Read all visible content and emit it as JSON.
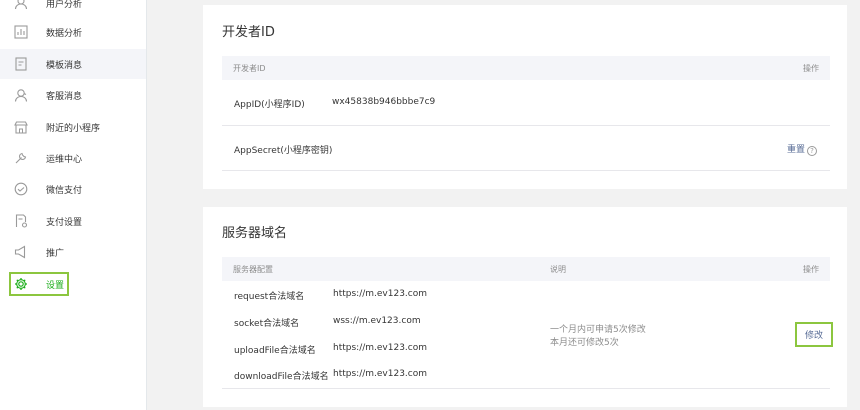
{
  "sidebar": {
    "items": [
      {
        "label": "用户分析",
        "icon": "user-icon"
      },
      {
        "label": "数据分析",
        "icon": "bar-chart-icon"
      },
      {
        "label": "模板消息",
        "icon": "template-doc-icon"
      },
      {
        "label": "客服消息",
        "icon": "customer-service-icon"
      },
      {
        "label": "附近的小程序",
        "icon": "store-icon"
      },
      {
        "label": "运维中心",
        "icon": "wrench-icon"
      },
      {
        "label": "微信支付",
        "icon": "check-circle-icon"
      },
      {
        "label": "支付设置",
        "icon": "payment-settings-icon"
      },
      {
        "label": "推广",
        "icon": "megaphone-icon"
      },
      {
        "label": "设置",
        "icon": "gear-icon"
      }
    ],
    "accent_color": "#1aad19",
    "highlight_color": "#8cc63f"
  },
  "developer_id": {
    "title": "开发者ID",
    "header_label": "开发者ID",
    "header_action": "操作",
    "appid_label": "AppID(小程序ID)",
    "appid_value": "wx45838b946bbbe7c9",
    "appsecret_label": "AppSecret(小程序密钥)",
    "reset_label": "重置",
    "help_icon": "?"
  },
  "server_domain": {
    "title": "服务器域名",
    "header_config": "服务器配置",
    "header_desc": "说明",
    "header_action": "操作",
    "rows": [
      {
        "label": "request合法域名",
        "value": "https://m.ev123.com"
      },
      {
        "label": "socket合法域名",
        "value": "wss://m.ev123.com"
      },
      {
        "label": "uploadFile合法域名",
        "value": "https://m.ev123.com"
      },
      {
        "label": "downloadFile合法域名",
        "value": "https://m.ev123.com"
      }
    ],
    "desc_line1": "一个月内可申请5次修改",
    "desc_line2": "本月还可修改5次",
    "edit_label": "修改"
  }
}
